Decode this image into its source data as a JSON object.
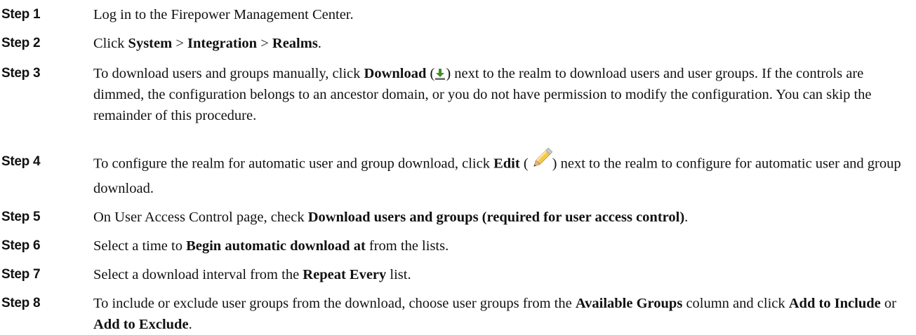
{
  "steps": [
    {
      "label": "Step 1",
      "parts": [
        {
          "t": "text",
          "v": "Log in to the Firepower Management Center."
        }
      ]
    },
    {
      "label": "Step 2",
      "parts": [
        {
          "t": "text",
          "v": "Click "
        },
        {
          "t": "bold",
          "v": "System"
        },
        {
          "t": "text",
          "v": " > "
        },
        {
          "t": "bold",
          "v": "Integration"
        },
        {
          "t": "text",
          "v": " > "
        },
        {
          "t": "bold",
          "v": "Realms"
        },
        {
          "t": "text",
          "v": "."
        }
      ]
    },
    {
      "label": "Step 3",
      "parts": [
        {
          "t": "text",
          "v": "To download users and groups manually, click "
        },
        {
          "t": "bold",
          "v": "Download"
        },
        {
          "t": "text",
          "v": " ("
        },
        {
          "t": "icon",
          "v": "download-icon"
        },
        {
          "t": "text",
          "v": ") next to the realm to download users and user groups. If the controls are dimmed, the configuration belongs to an ancestor domain, or you do not have permission to modify the configuration. You can skip the remainder of this procedure."
        }
      ]
    },
    {
      "label": "Step 4",
      "parts": [
        {
          "t": "text",
          "v": "To configure the realm for automatic user and group download, click "
        },
        {
          "t": "bold",
          "v": "Edit"
        },
        {
          "t": "text",
          "v": " ("
        },
        {
          "t": "icon",
          "v": "edit-pencil-icon"
        },
        {
          "t": "text",
          "v": ") next to the realm to configure for automatic user and group download."
        }
      ]
    },
    {
      "label": "Step 5",
      "parts": [
        {
          "t": "text",
          "v": "On User Access Control page, check "
        },
        {
          "t": "bold",
          "v": "Download users and groups (required for user access control)"
        },
        {
          "t": "text",
          "v": "."
        }
      ]
    },
    {
      "label": "Step 6",
      "parts": [
        {
          "t": "text",
          "v": "Select a time to "
        },
        {
          "t": "bold",
          "v": "Begin automatic download at"
        },
        {
          "t": "text",
          "v": " from the lists."
        }
      ]
    },
    {
      "label": "Step 7",
      "parts": [
        {
          "t": "text",
          "v": "Select a download interval from the "
        },
        {
          "t": "bold",
          "v": "Repeat Every"
        },
        {
          "t": "text",
          "v": " list."
        }
      ]
    },
    {
      "label": "Step 8",
      "parts": [
        {
          "t": "text",
          "v": "To include or exclude user groups from the download, choose user groups from the "
        },
        {
          "t": "bold",
          "v": "Available Groups"
        },
        {
          "t": "text",
          "v": " column and click "
        },
        {
          "t": "bold",
          "v": "Add to Include"
        },
        {
          "t": "text",
          "v": " or "
        },
        {
          "t": "bold",
          "v": "Add to Exclude"
        },
        {
          "t": "text",
          "v": "."
        }
      ]
    }
  ],
  "colors": {
    "text": "#111111",
    "download_icon_green": "#3f8f2a",
    "pencil_yellow": "#f2c94c",
    "pencil_tip": "#e8b48a"
  }
}
